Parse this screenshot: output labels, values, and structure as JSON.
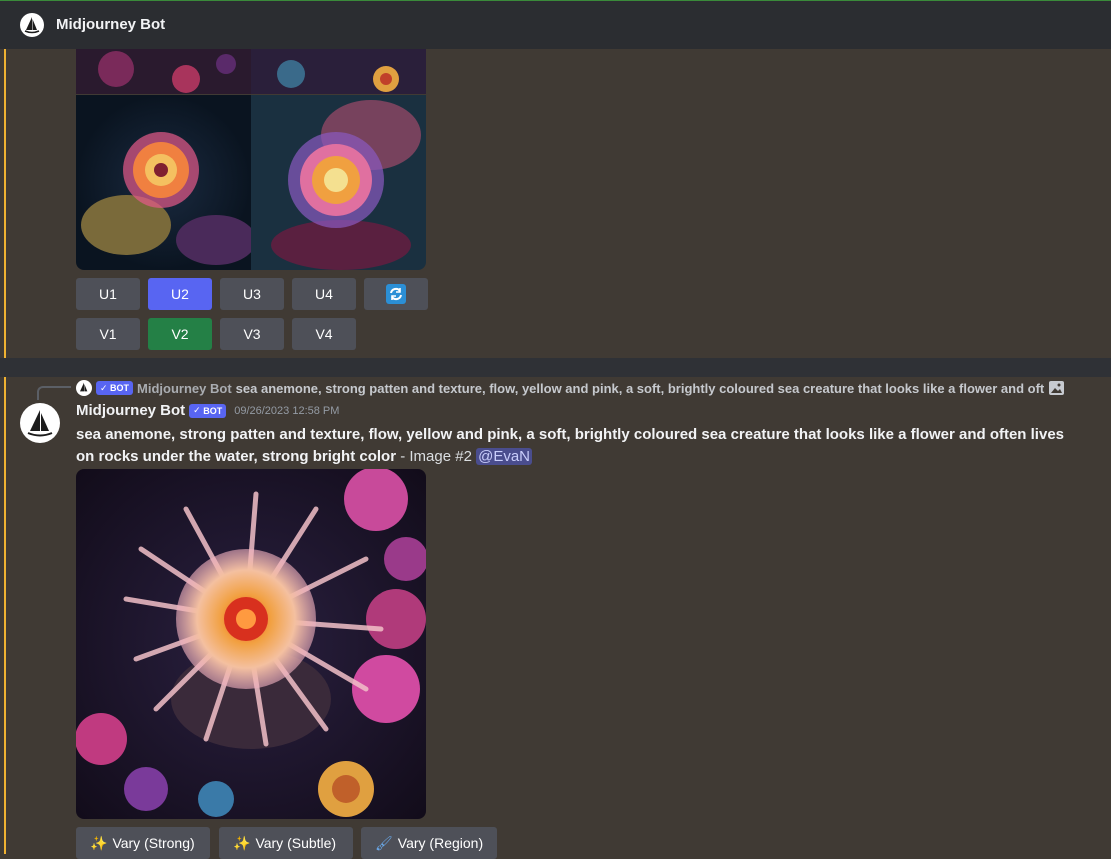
{
  "header": {
    "title": "Midjourney Bot"
  },
  "grid_buttons": {
    "upscale": [
      "U1",
      "U2",
      "U3",
      "U4"
    ],
    "variation": [
      "V1",
      "V2",
      "V3",
      "V4"
    ],
    "selected_upscale": "U2",
    "selected_variation": "V2"
  },
  "reply": {
    "badge": "BOT",
    "author": "Midjourney Bot",
    "text": "sea anemone, strong patten and texture, flow, yellow and pink, a soft, brightly coloured sea creature that looks like a flower and oft"
  },
  "message": {
    "author": "Midjourney Bot",
    "badge": "BOT",
    "timestamp": "09/26/2023 12:58 PM",
    "prompt": "sea anemone, strong patten and texture, flow, yellow and pink, a soft, brightly coloured sea creature that looks like a flower and often lives on rocks under the water, strong bright color",
    "suffix": " - Image #2 ",
    "mention": "@EvaN"
  },
  "actions": [
    {
      "label": "Vary (Strong)",
      "icon": "magic-wand-icon"
    },
    {
      "label": "Vary (Subtle)",
      "icon": "magic-wand-icon"
    },
    {
      "label": "Vary (Region)",
      "icon": "paintbrush-icon"
    }
  ],
  "colors": {
    "background": "#403a34",
    "header": "#2b2d31",
    "blurple": "#5865f2",
    "green": "#248046",
    "mention_bar": "#f0b232"
  }
}
